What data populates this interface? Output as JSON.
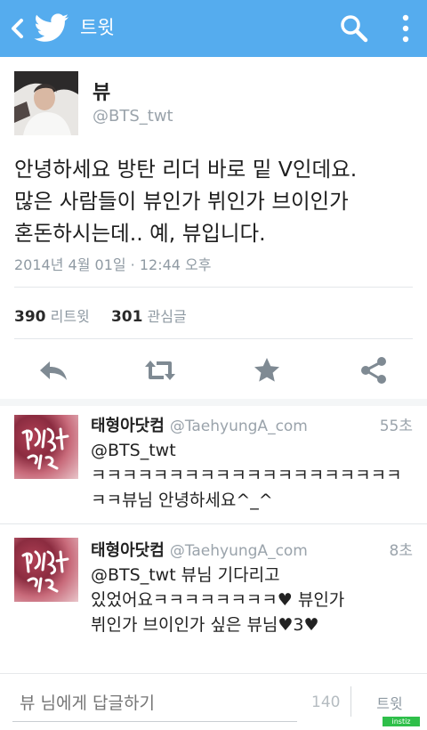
{
  "topbar": {
    "title": "트윗",
    "background": "#55acee",
    "icons": {
      "back": "chevron-left-icon",
      "logo": "twitter-bird-icon",
      "search": "search-icon",
      "more": "more-vertical-icon"
    }
  },
  "tweet": {
    "author_name": "뷰",
    "author_handle": "@BTS_twt",
    "text_lines": [
      "안녕하세요 방탄 리더 바로 밑 V인데요.",
      "많은 사람들이 뷰인가 뷔인가 브이인가",
      "혼돈하시는데.. 예, 뷰입니다."
    ],
    "date": "2014년 4월 01일 · 12:44 오후",
    "retweet_count": "390",
    "retweet_label": "리트윗",
    "favorite_count": "301",
    "favorite_label": "관심글"
  },
  "actions": {
    "reply": "reply-icon",
    "retweet": "retweet-icon",
    "favorite": "star-icon",
    "share": "share-icon"
  },
  "replies": [
    {
      "name": "태형아닷컴",
      "handle": "@TaehyungA_com",
      "time": "55초",
      "lines": [
        "@BTS_twt",
        "ㅋㅋㅋㅋㅋㅋㅋㅋㅋㅋㅋㅋㅋㅋㅋㅋㅋㅋㅋㅋ",
        "ㅋㅋ뷰님 안녕하세요^_^"
      ]
    },
    {
      "name": "태형아닷컴",
      "handle": "@TaehyungA_com",
      "time": "8초",
      "lines": [
        "@BTS_twt 뷰님 기다리고",
        "있었어요ㅋㅋㅋㅋㅋㅋㅋㅋ♥ 뷰인가",
        "뷔인가 브이인가 싶은 뷰님♥3♥"
      ]
    }
  ],
  "compose": {
    "placeholder": "뷰 님에게 답글하기",
    "counter": "140",
    "button_label": "트윗"
  },
  "watermark": "instiz"
}
